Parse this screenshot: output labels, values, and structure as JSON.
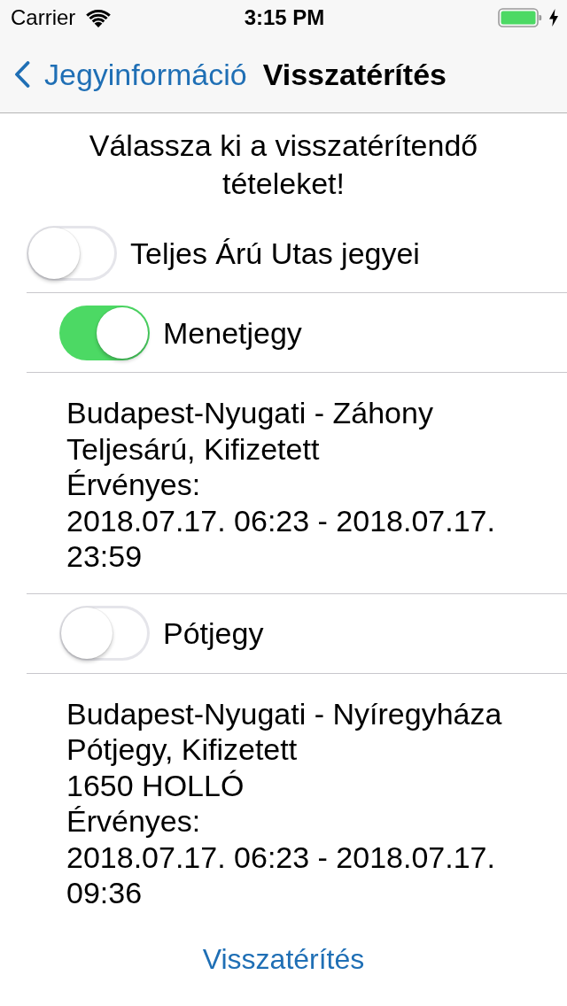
{
  "status_bar": {
    "carrier": "Carrier",
    "time": "3:15 PM",
    "charging": true
  },
  "nav_bar": {
    "back_label": "Jegyinformáció",
    "title": "Visszatérítés"
  },
  "instruction": "Válassza ki a visszatérítendő tételeket!",
  "passengers": [
    {
      "label": "Teljes Árú Utas jegyei",
      "on": false,
      "children": [
        {
          "label": "Menetjegy",
          "on": true,
          "details": {
            "route": "Budapest-Nyugati - Záhony",
            "fare": "Teljesárú, Kifizetett",
            "validity_label": "Érvényes:",
            "validity": "2018.07.17. 06:23 - 2018.07.17. 23:59"
          }
        },
        {
          "label": "Pótjegy",
          "on": false,
          "details": {
            "route": "Budapest-Nyugati - Nyíregyháza",
            "fare": "Pótjegy, Kifizetett",
            "train": "1650 HOLLÓ",
            "validity_label": "Érvényes:",
            "validity": "2018.07.17. 06:23 - 2018.07.17. 09:36"
          }
        }
      ]
    }
  ],
  "refund_button": "Visszatérítés"
}
